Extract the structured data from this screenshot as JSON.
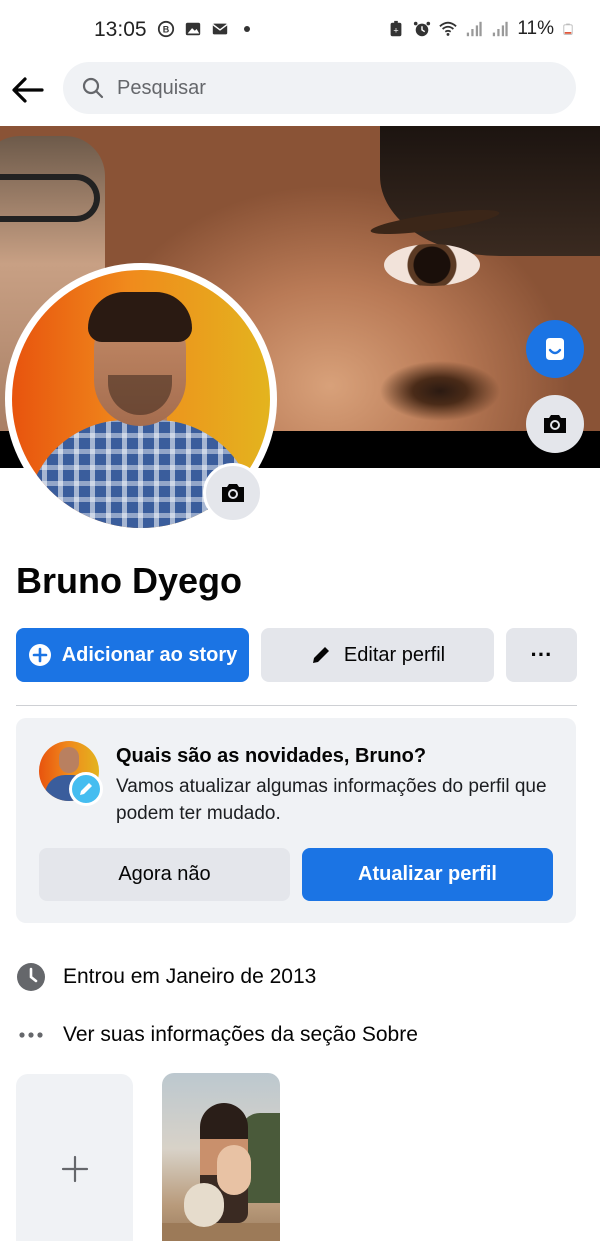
{
  "status_bar": {
    "time": "13:05",
    "battery": "11%",
    "left_icons": [
      "bixby-icon",
      "gallery-icon",
      "mail-icon",
      "dot-icon"
    ],
    "right_icons": [
      "battery-saver-icon",
      "alarm-icon",
      "wifi-icon",
      "signal-icon",
      "signal-icon",
      "battery-icon"
    ]
  },
  "header": {
    "search_placeholder": "Pesquisar"
  },
  "profile": {
    "name": "Bruno Dyego"
  },
  "actions": {
    "add_story": "Adicionar ao story",
    "edit_profile": "Editar perfil",
    "more": "···"
  },
  "update_card": {
    "title": "Quais são as novidades, Bruno?",
    "text": "Vamos atualizar algumas informações do perfil que podem ter mudado.",
    "later_button": "Agora não",
    "update_button": "Atualizar perfil"
  },
  "info": {
    "joined": "Entrou em Janeiro de 2013",
    "about": "Ver suas informações da seção Sobre"
  },
  "tiles": {
    "add_symbol": "+"
  },
  "colors": {
    "accent": "#1b74e4",
    "secondary_button": "#e4e6eb",
    "card_background": "#f0f2f5"
  }
}
